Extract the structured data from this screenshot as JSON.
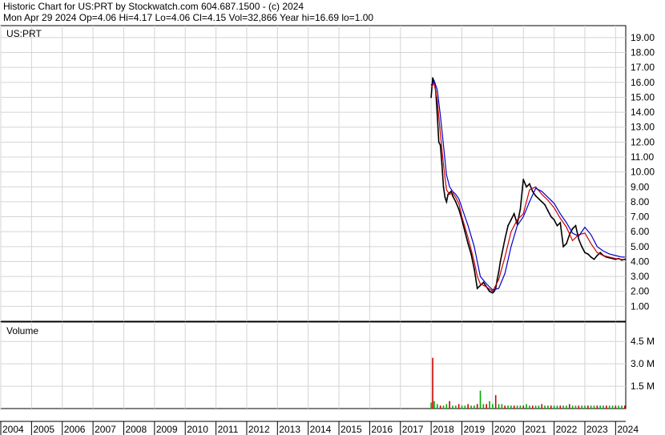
{
  "header": {
    "line1": "Historic Chart for US:PRT by Stockwatch.com 604.687.1500 - (c) 2024",
    "line2": "Mon Apr 29 2024  Op=4.06  Hi=4.17  Lo=4.06  Cl=4.15  Vol=32,866  Year hi=16.69  lo=1.00"
  },
  "colors": {
    "price": "#000000",
    "ma_short": "#cc0000",
    "ma_long": "#0000cc",
    "volume": "#00aa00",
    "volume_down": "#cc0000",
    "grid": "#d4d4d4"
  },
  "chart_data": [
    {
      "type": "line",
      "label": "US:PRT",
      "x_axis_type": "year",
      "xlim": [
        2004,
        2024.33
      ],
      "ylim": [
        0,
        19.8
      ],
      "yticks": [
        1,
        2,
        3,
        4,
        5,
        6,
        7,
        8,
        9,
        10,
        11,
        12,
        13,
        14,
        15,
        16,
        17,
        18,
        19
      ],
      "ytick_labels": [
        "1.00",
        "2.00",
        "3.00",
        "4.00",
        "5.00",
        "6.00",
        "7.00",
        "8.00",
        "9.00",
        "10.00",
        "11.00",
        "12.00",
        "13.00",
        "14.00",
        "15.00",
        "16.00",
        "17.00",
        "18.00",
        "19.00"
      ],
      "xtick_labels": [
        "2004",
        "2005",
        "2006",
        "2007",
        "2008",
        "2009",
        "2010",
        "2011",
        "2012",
        "2013",
        "2014",
        "2015",
        "2016",
        "2017",
        "2018",
        "2019",
        "2020",
        "2021",
        "2022",
        "2023",
        "2024"
      ],
      "grid": true,
      "series": [
        {
          "x": [
            2018.0,
            2018.05,
            2018.1,
            2018.15,
            2018.2,
            2018.25,
            2018.3,
            2018.35,
            2018.4,
            2018.45,
            2018.5,
            2018.55,
            2018.6,
            2018.65,
            2018.7,
            2018.8,
            2018.9,
            2019.0,
            2019.1,
            2019.2,
            2019.3,
            2019.4,
            2019.5,
            2019.6,
            2019.7,
            2019.8,
            2019.9,
            2020.0,
            2020.05,
            2020.1,
            2020.15,
            2020.2,
            2020.25,
            2020.3,
            2020.4,
            2020.5,
            2020.6,
            2020.7,
            2020.8,
            2020.9,
            2021.0,
            2021.1,
            2021.2,
            2021.3,
            2021.4,
            2021.5,
            2021.6,
            2021.7,
            2021.8,
            2021.9,
            2022.0,
            2022.1,
            2022.2,
            2022.3,
            2022.4,
            2022.5,
            2022.6,
            2022.7,
            2022.8,
            2022.9,
            2023.0,
            2023.1,
            2023.2,
            2023.3,
            2023.4,
            2023.5,
            2023.6,
            2023.7,
            2023.8,
            2023.9,
            2024.0,
            2024.1,
            2024.2,
            2024.3
          ],
          "y": [
            15.0,
            16.3,
            16.0,
            15.4,
            13.8,
            12.0,
            11.8,
            10.5,
            9.0,
            8.3,
            8.0,
            8.5,
            8.6,
            8.7,
            8.4,
            8.0,
            7.5,
            6.8,
            6.0,
            5.2,
            4.5,
            3.5,
            2.2,
            2.4,
            2.6,
            2.3,
            2.0,
            1.9,
            2.0,
            2.2,
            2.8,
            3.3,
            4.0,
            4.5,
            5.5,
            6.4,
            6.8,
            7.2,
            6.5,
            7.5,
            9.5,
            9.0,
            9.2,
            8.7,
            8.4,
            8.2,
            8.0,
            7.8,
            7.4,
            7.0,
            6.8,
            6.4,
            6.6,
            5.0,
            5.2,
            5.8,
            6.2,
            6.4,
            5.5,
            5.0,
            4.6,
            4.5,
            4.3,
            4.15,
            4.4,
            4.6,
            4.4,
            4.3,
            4.25,
            4.2,
            4.15,
            4.2,
            4.1,
            4.15
          ]
        },
        {
          "x": [
            2018.0,
            2018.1,
            2018.2,
            2018.3,
            2018.4,
            2018.5,
            2018.6,
            2018.7,
            2018.8,
            2018.9,
            2019.0,
            2019.2,
            2019.4,
            2019.5,
            2019.6,
            2019.8,
            2020.0,
            2020.2,
            2020.4,
            2020.6,
            2020.8,
            2021.0,
            2021.2,
            2021.4,
            2021.6,
            2021.8,
            2022.0,
            2022.2,
            2022.4,
            2022.6,
            2022.8,
            2023.0,
            2023.2,
            2023.4,
            2023.6,
            2023.8,
            2024.0,
            2024.2,
            2024.3
          ],
          "y": [
            15.6,
            16.0,
            14.8,
            12.6,
            10.5,
            8.8,
            8.5,
            8.6,
            8.3,
            7.9,
            7.0,
            5.6,
            4.0,
            3.0,
            2.5,
            2.3,
            2.0,
            2.8,
            4.3,
            6.0,
            6.8,
            7.2,
            8.8,
            9.0,
            8.5,
            8.1,
            7.6,
            6.9,
            6.3,
            5.4,
            5.8,
            5.9,
            5.2,
            4.6,
            4.4,
            4.3,
            4.2,
            4.15,
            4.12
          ]
        },
        {
          "x": [
            2018.0,
            2018.1,
            2018.2,
            2018.3,
            2018.4,
            2018.5,
            2018.6,
            2018.7,
            2018.8,
            2018.9,
            2019.0,
            2019.2,
            2019.4,
            2019.5,
            2019.6,
            2019.8,
            2020.0,
            2020.2,
            2020.4,
            2020.6,
            2020.8,
            2021.0,
            2021.2,
            2021.4,
            2021.6,
            2021.8,
            2022.0,
            2022.2,
            2022.4,
            2022.6,
            2022.8,
            2023.0,
            2023.2,
            2023.4,
            2023.6,
            2023.8,
            2024.0,
            2024.2,
            2024.3
          ],
          "y": [
            15.8,
            16.1,
            15.5,
            13.8,
            11.8,
            9.8,
            9.0,
            8.7,
            8.5,
            8.2,
            7.6,
            6.4,
            5.0,
            4.0,
            3.0,
            2.5,
            2.1,
            2.2,
            3.2,
            5.0,
            6.4,
            7.0,
            8.0,
            8.9,
            8.7,
            8.3,
            7.9,
            7.2,
            6.6,
            5.9,
            5.7,
            6.3,
            5.8,
            5.0,
            4.7,
            4.5,
            4.4,
            4.3,
            4.3
          ]
        }
      ]
    },
    {
      "type": "bar",
      "label": "Volume",
      "yticks": [
        1.5,
        3.0,
        4.5
      ],
      "ytick_labels": [
        "1.5 M",
        "3.0 M",
        "4.5 M"
      ],
      "ylim": [
        0,
        5.8
      ],
      "series": [
        {
          "x": [
            2018.0,
            2018.05,
            2018.1,
            2018.2,
            2018.3,
            2018.4,
            2018.5,
            2018.6,
            2018.7,
            2018.8,
            2018.9,
            2019.0,
            2019.1,
            2019.2,
            2019.3,
            2019.4,
            2019.5,
            2019.6,
            2019.7,
            2019.8,
            2019.9,
            2020.0,
            2020.1,
            2020.2,
            2020.3,
            2020.4,
            2020.5,
            2020.6,
            2020.7,
            2020.8,
            2020.9,
            2021.0,
            2021.1,
            2021.2,
            2021.3,
            2021.4,
            2021.5,
            2021.6,
            2021.7,
            2021.8,
            2021.9,
            2022.0,
            2022.1,
            2022.2,
            2022.3,
            2022.4,
            2022.5,
            2022.6,
            2022.7,
            2022.8,
            2022.9,
            2023.0,
            2023.1,
            2023.2,
            2023.3,
            2023.4,
            2023.5,
            2023.6,
            2023.7,
            2023.8,
            2023.9,
            2024.0,
            2024.1,
            2024.2,
            2024.3
          ],
          "values": [
            0.4,
            3.4,
            0.5,
            0.3,
            0.2,
            0.2,
            0.3,
            0.5,
            0.2,
            0.2,
            0.3,
            0.2,
            0.2,
            0.3,
            0.2,
            0.2,
            0.3,
            1.2,
            0.3,
            0.3,
            0.5,
            0.3,
            0.9,
            0.3,
            0.3,
            0.2,
            0.2,
            0.2,
            0.2,
            0.2,
            0.2,
            0.2,
            0.3,
            0.2,
            0.2,
            0.2,
            0.2,
            0.3,
            0.2,
            0.2,
            0.2,
            0.2,
            0.2,
            0.2,
            0.2,
            0.2,
            0.3,
            0.2,
            0.2,
            0.2,
            0.2,
            0.2,
            0.2,
            0.2,
            0.2,
            0.2,
            0.2,
            0.2,
            0.2,
            0.2,
            0.2,
            0.2,
            0.2,
            0.2,
            0.2
          ]
        }
      ]
    }
  ]
}
